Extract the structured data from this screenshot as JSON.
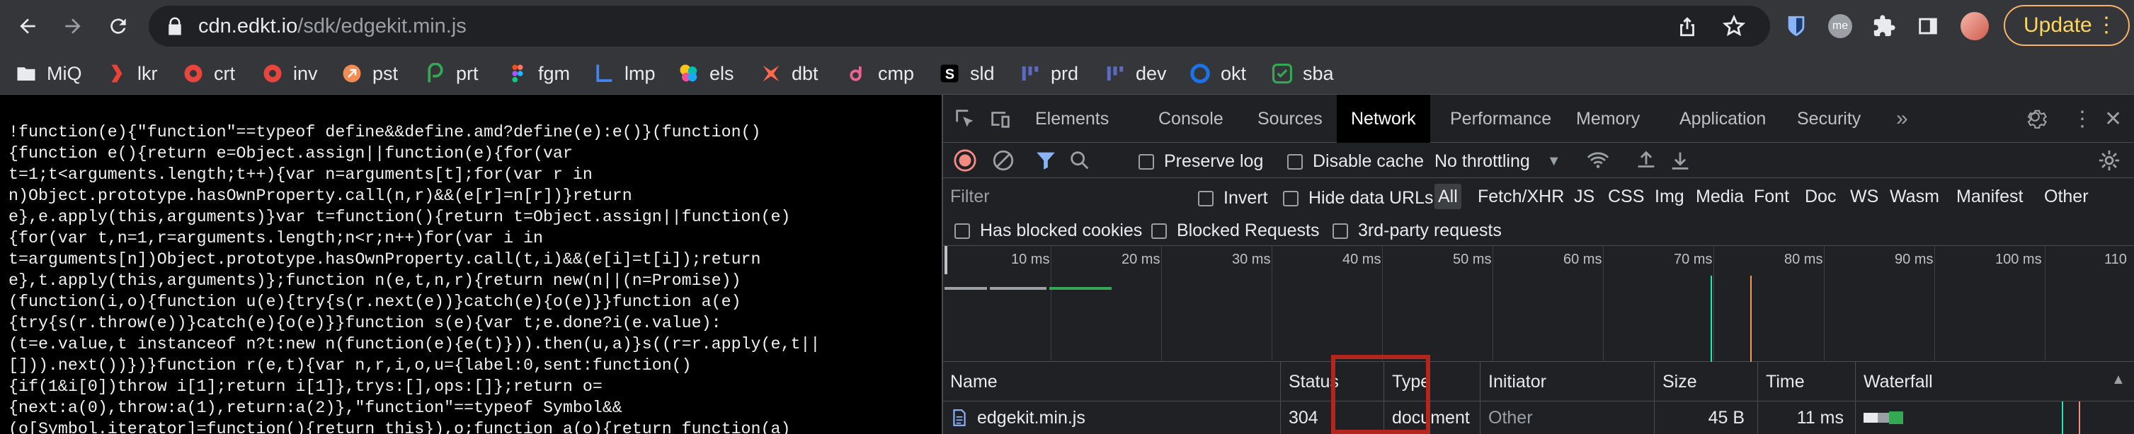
{
  "browser": {
    "url_host": "cdn.edkt.io",
    "url_path": "/sdk/edgekit.min.js",
    "update_label": "Update",
    "profile_badge": "me"
  },
  "bookmarks": [
    {
      "label": "MiQ",
      "icon": "folder-icon"
    },
    {
      "label": "lkr",
      "icon": "lkr-icon"
    },
    {
      "label": "crt",
      "icon": "crt-icon"
    },
    {
      "label": "inv",
      "icon": "inv-icon"
    },
    {
      "label": "pst",
      "icon": "pst-icon"
    },
    {
      "label": "prt",
      "icon": "prt-icon"
    },
    {
      "label": "fgm",
      "icon": "figma-icon"
    },
    {
      "label": "lmp",
      "icon": "lmp-icon"
    },
    {
      "label": "els",
      "icon": "elastic-icon"
    },
    {
      "label": "dbt",
      "icon": "dbt-icon"
    },
    {
      "label": "cmp",
      "icon": "cmp-icon"
    },
    {
      "label": "sld",
      "icon": "sld-icon"
    },
    {
      "label": "prd",
      "icon": "prd-icon"
    },
    {
      "label": "dev",
      "icon": "dev-icon"
    },
    {
      "label": "okt",
      "icon": "okta-icon"
    },
    {
      "label": "sba",
      "icon": "sba-icon"
    }
  ],
  "source_lines": [
    "!function(e){\"function\"==typeof define&&define.amd?define(e):e()}(function()",
    "{function e(){return e=Object.assign||function(e){for(var",
    "t=1;t<arguments.length;t++){var n=arguments[t];for(var r in",
    "n)Object.prototype.hasOwnProperty.call(n,r)&&(e[r]=n[r])}return",
    "e},e.apply(this,arguments)}var t=function(){return t=Object.assign||function(e)",
    "{for(var t,n=1,r=arguments.length;n<r;n++)for(var i in",
    "t=arguments[n])Object.prototype.hasOwnProperty.call(t,i)&&(e[i]=t[i]);return",
    "e},t.apply(this,arguments)};function n(e,t,n,r){return new(n||(n=Promise))",
    "(function(i,o){function u(e){try{s(r.next(e))}catch(e){o(e)}}function a(e)",
    "{try{s(r.throw(e))}catch(e){o(e)}}function s(e){var t;e.done?i(e.value):",
    "(t=e.value,t instanceof n?t:new n(function(e){e(t)})).then(u,a)}s((r=r.apply(e,t||",
    "[])).next())})}function r(e,t){var n,r,i,o,u={label:0,sent:function()",
    "{if(1&i[0])throw i[1];return i[1]},trys:[],ops:[]};return o=",
    "{next:a(0),throw:a(1),return:a(2)},\"function\"==typeof Symbol&&",
    "(o[Symbol.iterator]=function(){return this}),o;function a(o){return function(a)"
  ],
  "devtools": {
    "tabs": [
      "Elements",
      "Console",
      "Sources",
      "Network",
      "Performance",
      "Memory",
      "Application",
      "Security"
    ],
    "active_tab": "Network",
    "preserve_log": "Preserve log",
    "disable_cache": "Disable cache",
    "throttling": "No throttling",
    "filter_placeholder": "Filter",
    "invert": "Invert",
    "hide_data_urls": "Hide data URLs",
    "filter_types": [
      "All",
      "Fetch/XHR",
      "JS",
      "CSS",
      "Img",
      "Media",
      "Font",
      "Doc",
      "WS",
      "Wasm",
      "Manifest",
      "Other"
    ],
    "has_blocked_cookies": "Has blocked cookies",
    "blocked_requests": "Blocked Requests",
    "third_party": "3rd-party requests",
    "timeline_ticks": [
      "10 ms",
      "20 ms",
      "30 ms",
      "40 ms",
      "50 ms",
      "60 ms",
      "70 ms",
      "80 ms",
      "90 ms",
      "100 ms",
      "110"
    ],
    "columns": [
      "Name",
      "Status",
      "Type",
      "Initiator",
      "Size",
      "Time",
      "Waterfall"
    ],
    "rows": [
      {
        "name": "edgekit.min.js",
        "status": "304",
        "type": "document",
        "initiator": "Other",
        "size": "45 B",
        "time": "11 ms"
      }
    ]
  },
  "colors": {
    "accent": "#8ab4f8",
    "highlight_box": "#b3261e",
    "record": "#f28b82"
  }
}
